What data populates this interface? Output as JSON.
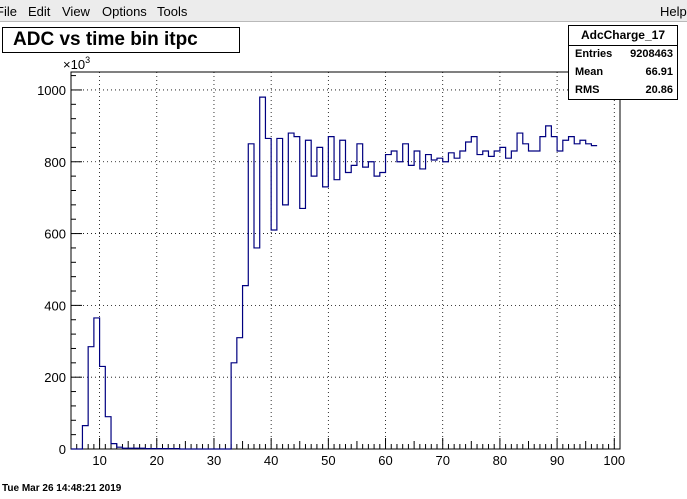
{
  "menu": {
    "file": "File",
    "edit": "Edit",
    "view": "View",
    "options": "Options",
    "tools": "Tools",
    "help": "Help"
  },
  "title": "ADC vs time bin itpc",
  "stats": {
    "name": "AdcCharge_17",
    "entries_label": "Entries",
    "entries_value": "9208463",
    "mean_label": "Mean",
    "mean_value": "66.91",
    "rms_label": "RMS",
    "rms_value": "20.86"
  },
  "footer": "Tue Mar 26 14:48:21 2019",
  "chart_data": {
    "type": "histogram",
    "title": "ADC vs time bin itpc",
    "xlabel": "",
    "ylabel": "",
    "xlim": [
      5,
      101
    ],
    "ylim": [
      0,
      1050
    ],
    "y_multiplier": "×10^3",
    "y_multiplier_base": "×10",
    "y_multiplier_exp": "3",
    "grid": true,
    "line_color": "#000080",
    "x_ticks": [
      10,
      20,
      30,
      40,
      50,
      60,
      70,
      80,
      90,
      100
    ],
    "y_ticks": [
      0,
      200,
      400,
      600,
      800,
      1000
    ],
    "bins": {
      "start": 5,
      "width": 1,
      "values": [
        0,
        0,
        65,
        285,
        365,
        230,
        90,
        15,
        5,
        2,
        2,
        2,
        2,
        1,
        1,
        1,
        1,
        1,
        1,
        0,
        0,
        0,
        0,
        0,
        0,
        0,
        0,
        0,
        240,
        310,
        455,
        850,
        560,
        980,
        865,
        610,
        865,
        680,
        880,
        870,
        670,
        860,
        760,
        840,
        730,
        870,
        750,
        860,
        770,
        790,
        850,
        785,
        800,
        760,
        770,
        820,
        830,
        800,
        850,
        790,
        830,
        780,
        820,
        805,
        810,
        800,
        825,
        810,
        830,
        855,
        870,
        820,
        830,
        815,
        830,
        840,
        810,
        830,
        880,
        850,
        830,
        830,
        870,
        900,
        870,
        830,
        860,
        870,
        850,
        860,
        850,
        845
      ]
    }
  }
}
